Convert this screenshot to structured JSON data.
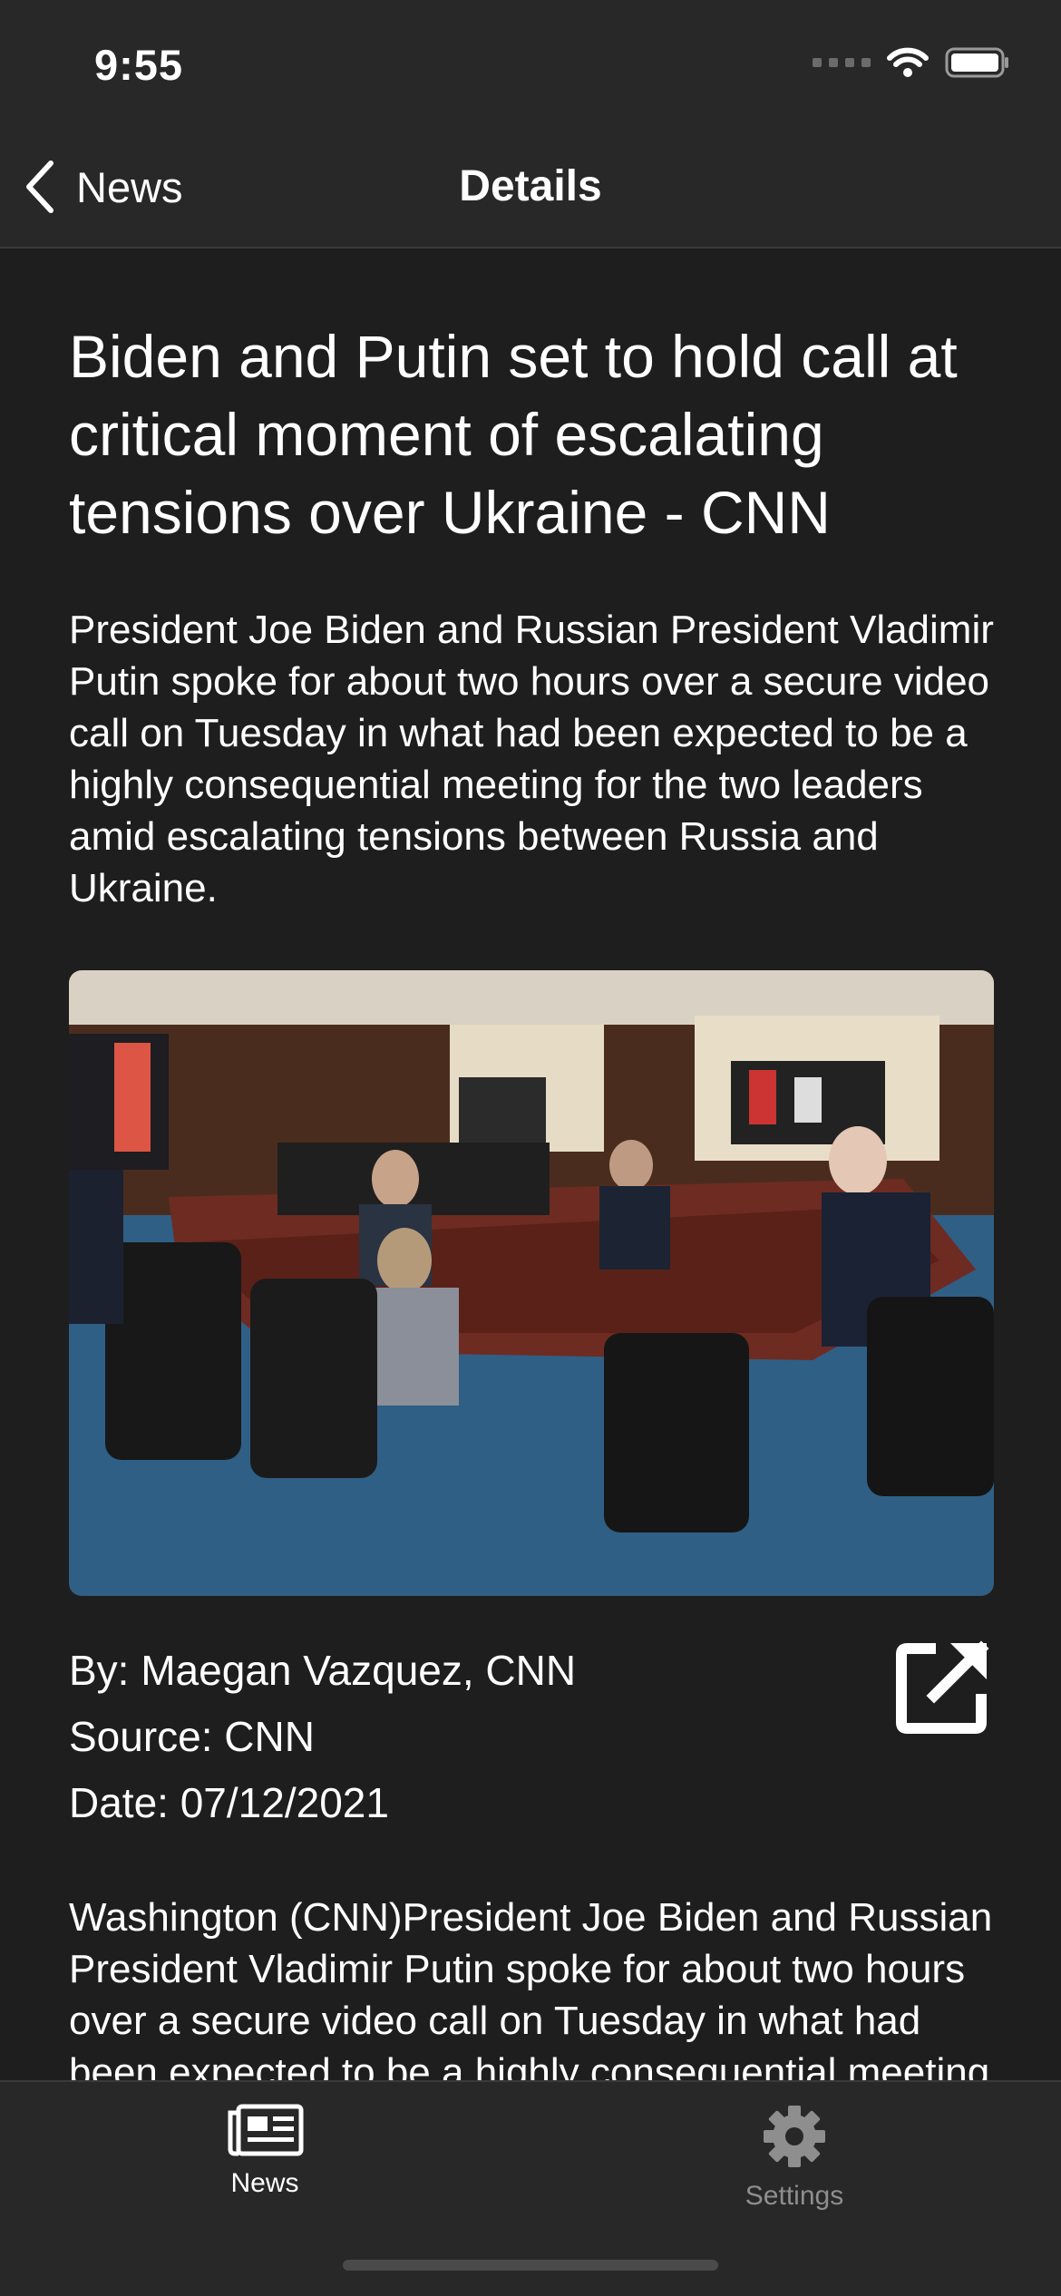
{
  "status_bar": {
    "time": "9:55"
  },
  "nav": {
    "back_label": "News",
    "title": "Details"
  },
  "article": {
    "headline": "Biden and Putin set to hold call at critical moment of escalating tensions over Ukraine - CNN",
    "summary": "President Joe Biden and Russian President Vladimir Putin spoke for about two hours over a secure video call on Tuesday in what had been expected to be a highly consequential meeting for the two leaders amid escalating tensions between Russia and Ukraine.",
    "author": "By: Maegan Vazquez, CNN",
    "source": "Source: CNN",
    "date": "Date: 07/12/2021",
    "body": "Washington (CNN)President Joe Biden and Russian President Vladimir Putin spoke for about two hours over a secure video call on Tuesday in what had been expected to be a highly consequential meeting for the two leaders amid escalating tensions between Russia and Ukraine."
  },
  "icons": {
    "back": "chevron-left-icon",
    "share": "open-external-icon",
    "news_tab": "newspaper-icon",
    "settings_tab": "gear-icon"
  },
  "tabbar": {
    "items": [
      {
        "label": "News",
        "active": true
      },
      {
        "label": "Settings",
        "active": false
      }
    ]
  },
  "colors": {
    "background": "#1e1e1e",
    "bar": "#282828",
    "text": "#ffffff",
    "inactive": "#8e8e8e"
  }
}
